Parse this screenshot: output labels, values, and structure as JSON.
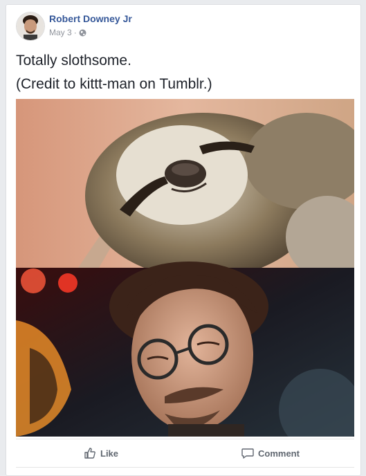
{
  "post": {
    "author": "Robert Downey Jr",
    "date": "May 3",
    "separator": "·",
    "privacy_icon": "globe-icon",
    "text_lines": [
      "Totally slothsome.",
      "(Credit to kittt-man on Tumblr.)"
    ]
  },
  "actions": {
    "like_label": "Like",
    "like_icon": "thumbs-up-icon",
    "comment_label": "Comment",
    "comment_icon": "speech-bubble-icon"
  },
  "colors": {
    "author_link": "#365899",
    "meta_text": "#90949c",
    "body_text": "#1d2129",
    "action_text": "#606770",
    "page_bg": "#e9ebee"
  }
}
